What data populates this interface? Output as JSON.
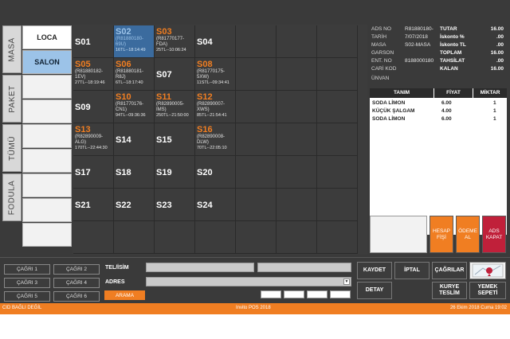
{
  "side_tabs": [
    "MASA",
    "PAKET",
    "TÜMÜ",
    "FODULA"
  ],
  "categories": [
    "LOCA",
    "SALON"
  ],
  "tables": [
    {
      "id": "S01",
      "state": "idle"
    },
    {
      "id": "S02",
      "state": "selected",
      "ref": "(R81880180-69U)",
      "time": "16TL--18:14:49"
    },
    {
      "id": "S03",
      "state": "busy",
      "ref": "(R81770177-FDA)",
      "time": "25TL--10:06:24"
    },
    {
      "id": "S04",
      "state": "idle"
    },
    {
      "id": "S05",
      "state": "busy",
      "ref": "(R81880182-1EV)",
      "time": "27TL--18:19:46"
    },
    {
      "id": "S06",
      "state": "busy",
      "ref": "(R81880181-R8J)",
      "time": "6TL--18:17:40"
    },
    {
      "id": "S07",
      "state": "idle"
    },
    {
      "id": "S08",
      "state": "busy",
      "ref": "(R81770175-5XW)",
      "time": "11STL--09:34:41"
    },
    {
      "id": "S09",
      "state": "idle"
    },
    {
      "id": "S10",
      "state": "busy",
      "ref": "(R81770176-CN1)",
      "time": "94TL--09:36:36"
    },
    {
      "id": "S11",
      "state": "busy",
      "ref": "(R82890005-IMS)",
      "time": "250TL--21:50:00"
    },
    {
      "id": "S12",
      "state": "busy",
      "ref": "(R82890007-XWS)",
      "time": "85TL--21:54:41"
    },
    {
      "id": "S13",
      "state": "busy",
      "ref": "(R82890009-ALG)",
      "time": "170TL--22:44:30"
    },
    {
      "id": "S14",
      "state": "idle"
    },
    {
      "id": "S15",
      "state": "idle"
    },
    {
      "id": "S16",
      "state": "busy",
      "ref": "(R82890008-DLW)",
      "time": "70TL--22:05:10"
    },
    {
      "id": "S17",
      "state": "idle"
    },
    {
      "id": "S18",
      "state": "idle"
    },
    {
      "id": "S19",
      "state": "idle"
    },
    {
      "id": "S20",
      "state": "idle"
    },
    {
      "id": "S21",
      "state": "idle"
    },
    {
      "id": "S22",
      "state": "idle"
    },
    {
      "id": "S23",
      "state": "idle"
    },
    {
      "id": "S24",
      "state": "idle"
    }
  ],
  "order_info": {
    "ads_no_label": "ADS NO",
    "ads_no": "R81880180-",
    "tarih_label": "TARİH",
    "tarih": "7/07/2018",
    "masa_label": "MASA",
    "masa": "S02-MASA",
    "garson_label": "GARSON",
    "garson": "",
    "ent_no_label": "ENT. NO",
    "ent_no": "8188000180",
    "cari_label": "CARİ KOD",
    "cari": "",
    "unvan_label": "ÜNVAN"
  },
  "totals": [
    {
      "label": "TUTAR",
      "value": "16.00"
    },
    {
      "label": "İskonto %",
      "value": ".00"
    },
    {
      "label": "İskonto TL",
      "value": ".00"
    },
    {
      "label": "TOPLAM",
      "value": "16.00"
    },
    {
      "label": "TAHSİLAT",
      "value": ".00"
    },
    {
      "label": "KALAN",
      "value": "16.00"
    }
  ],
  "order_table": {
    "headers": [
      "TANIM",
      "FİYAT",
      "MİKTAR"
    ],
    "rows": [
      [
        "SODA LİMON",
        "6.00",
        "1"
      ],
      [
        "KÜÇÜK ŞALGAM",
        "4.00",
        "1"
      ],
      [
        "SODA LİMON",
        "6.00",
        "1"
      ]
    ]
  },
  "action_buttons_right": {
    "hesap": "HESAP FİŞİ",
    "odeme": "ÖDEME AL",
    "ads_kapat": "ADS KAPAT"
  },
  "call_buttons": [
    "ÇAĞRI 1",
    "ÇAĞRI 2",
    "ÇAĞRI 3",
    "ÇAĞRI 4",
    "ÇAĞRI 5",
    "ÇAĞRI 6"
  ],
  "customer": {
    "tel_label": "TEL/İSİM",
    "adres_label": "ADRES",
    "search_label": "ARAMA"
  },
  "lower_buttons": {
    "kaydet": "KAYDET",
    "iptal": "İPTAL",
    "cagrilar": "ÇAĞRILAR",
    "detay": "DETAY",
    "kurye": "KURYE TESLİM",
    "yemek": "YEMEK SEPETİ"
  },
  "status": {
    "left": "CID BAĞLI DEĞİL",
    "center": "Invito POS 2018",
    "right": "26 Ekim 2018 Cuma 19:02"
  },
  "colors": {
    "accent": "#f07e22",
    "selected": "#3b6b9e",
    "close_button": "#c0203a"
  }
}
